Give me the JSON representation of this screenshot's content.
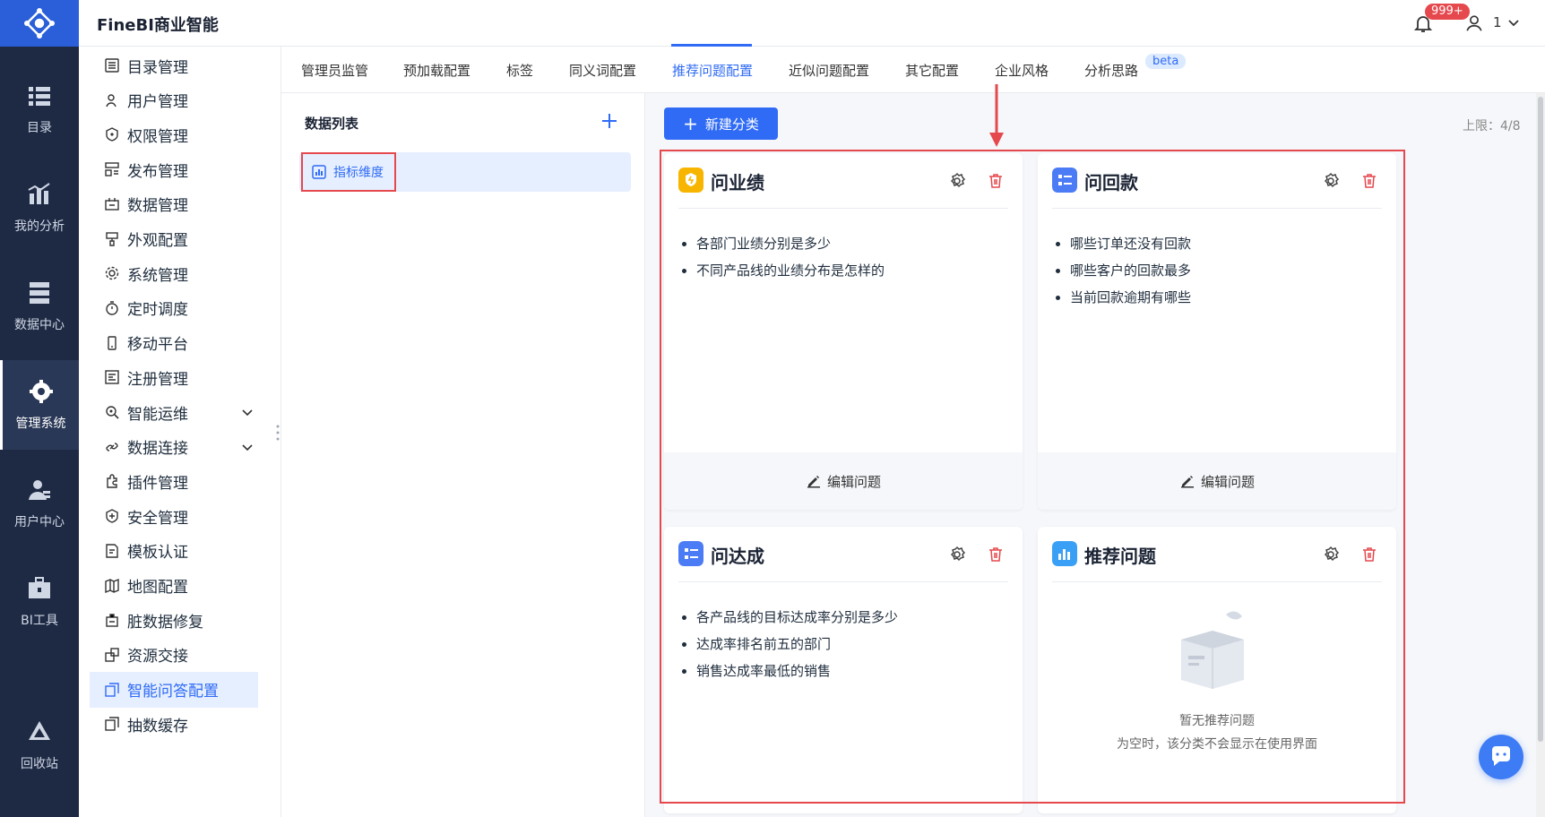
{
  "header": {
    "app_title": "FineBI商业智能",
    "notification_badge": "999+",
    "user_name": "1",
    "brand_color": "#2a5fd9"
  },
  "left_nav": [
    {
      "label": "目录",
      "icon": "catalog-icon"
    },
    {
      "label": "我的分析",
      "icon": "analysis-icon"
    },
    {
      "label": "数据中心",
      "icon": "data-center-icon"
    },
    {
      "label": "管理系统",
      "icon": "admin-gear-icon",
      "active": true
    },
    {
      "label": "用户中心",
      "icon": "user-center-icon"
    },
    {
      "label": "BI工具",
      "icon": "toolbox-icon"
    },
    {
      "label": "回收站",
      "icon": "recycle-icon"
    }
  ],
  "sidebar": {
    "items": [
      {
        "label": "目录管理",
        "icon": "list-icon"
      },
      {
        "label": "用户管理",
        "icon": "user-icon"
      },
      {
        "label": "权限管理",
        "icon": "permission-icon"
      },
      {
        "label": "发布管理",
        "icon": "publish-icon"
      },
      {
        "label": "数据管理",
        "icon": "data-icon"
      },
      {
        "label": "外观配置",
        "icon": "paint-icon"
      },
      {
        "label": "系统管理",
        "icon": "gear-icon"
      },
      {
        "label": "定时调度",
        "icon": "timer-icon"
      },
      {
        "label": "移动平台",
        "icon": "mobile-icon"
      },
      {
        "label": "注册管理",
        "icon": "register-icon"
      },
      {
        "label": "智能运维",
        "icon": "ops-icon",
        "expandable": true
      },
      {
        "label": "数据连接",
        "icon": "link-icon",
        "expandable": true
      },
      {
        "label": "插件管理",
        "icon": "plugin-icon"
      },
      {
        "label": "安全管理",
        "icon": "shield-icon"
      },
      {
        "label": "模板认证",
        "icon": "template-icon"
      },
      {
        "label": "地图配置",
        "icon": "map-icon"
      },
      {
        "label": "脏数据修复",
        "icon": "repair-icon"
      },
      {
        "label": "资源交接",
        "icon": "handover-icon"
      },
      {
        "label": "智能问答配置",
        "icon": "qa-config-icon",
        "active": true
      },
      {
        "label": "抽数缓存",
        "icon": "cache-icon"
      }
    ]
  },
  "tabs": [
    {
      "label": "管理员监管"
    },
    {
      "label": "预加载配置"
    },
    {
      "label": "标签"
    },
    {
      "label": "同义词配置"
    },
    {
      "label": "推荐问题配置",
      "active": true
    },
    {
      "label": "近似问题配置"
    },
    {
      "label": "其它配置"
    },
    {
      "label": "企业风格"
    },
    {
      "label": "分析思路"
    }
  ],
  "beta_badge": "beta",
  "data_list": {
    "title": "数据列表",
    "items": [
      {
        "label": "指标维度"
      }
    ]
  },
  "main": {
    "new_button_label": "新建分类",
    "limit_text": "上限：4/8",
    "edit_label": "编辑问题",
    "cards": [
      {
        "title": "问业绩",
        "icon": "shield-badge-icon",
        "icon_color": "#f7b500",
        "questions": [
          "各部门业绩分别是多少",
          "不同产品线的业绩分布是怎样的"
        ]
      },
      {
        "title": "问回款",
        "icon": "list-card-icon",
        "icon_color": "#4b7bf5",
        "questions": [
          "哪些订单还没有回款",
          "哪些客户的回款最多",
          "当前回款逾期有哪些"
        ]
      },
      {
        "title": "问达成",
        "icon": "list-card-icon",
        "icon_color": "#4b7bf5",
        "questions": [
          "各产品线的目标达成率分别是多少",
          "达成率排名前五的部门",
          "销售达成率最低的销售"
        ]
      },
      {
        "title": "推荐问题",
        "icon": "bar-chart-icon",
        "icon_color": "#3aa0f5",
        "questions": [],
        "empty_title": "暂无推荐问题",
        "empty_sub": "为空时，该分类不会显示在使用界面"
      }
    ]
  },
  "accent_color": "#2f6bf5",
  "highlight_color": "#e5484d"
}
